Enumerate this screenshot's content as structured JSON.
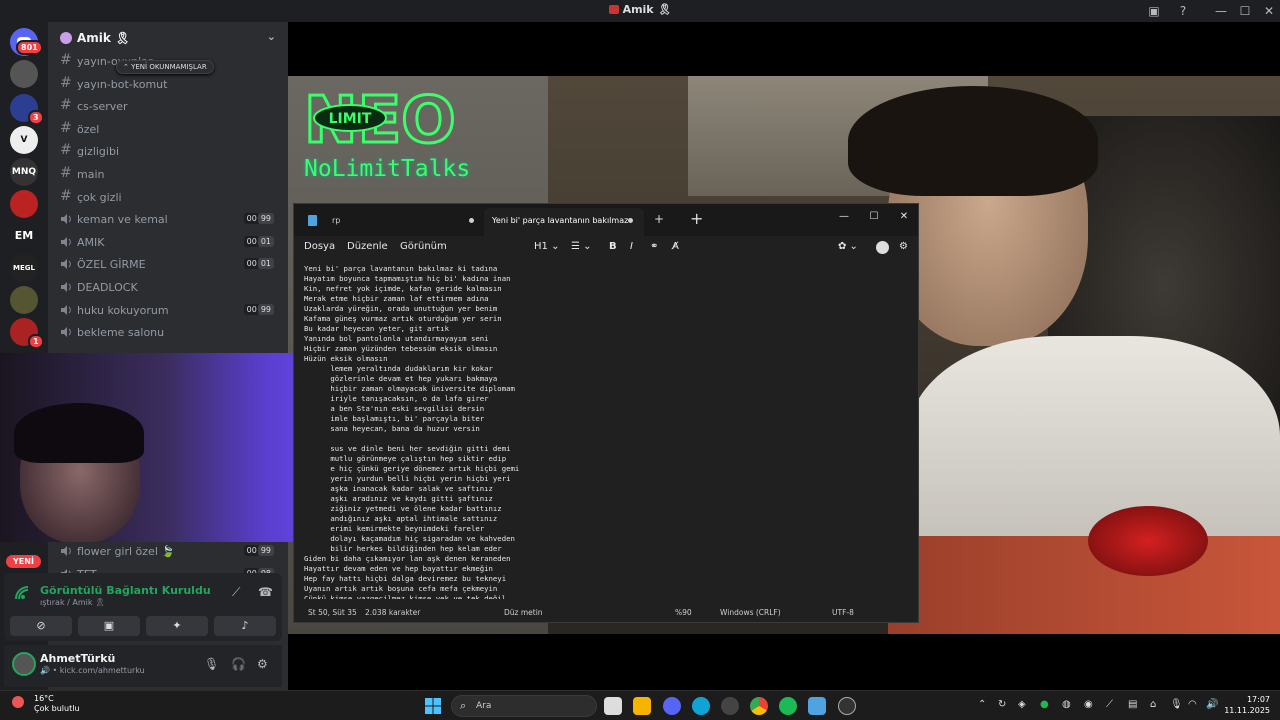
{
  "window": {
    "title": "Amik 🎗"
  },
  "servers": [
    {
      "name": "server-1",
      "badge": "801",
      "color": "#c0392b"
    },
    {
      "name": "server-2",
      "badge": "",
      "color": "#444"
    },
    {
      "name": "server-3",
      "badge": "3",
      "color": "#2c3e91"
    },
    {
      "name": "server-4",
      "badge": "",
      "color": "#eee"
    },
    {
      "name": "MNQ",
      "badge": "",
      "color": "#333"
    },
    {
      "name": "server-6",
      "badge": "",
      "color": "#b22"
    },
    {
      "name": "EM",
      "badge": "",
      "color": "#1e1f22"
    },
    {
      "name": "MEGL",
      "badge": "",
      "color": "#222"
    },
    {
      "name": "server-9",
      "badge": "",
      "color": "#553"
    },
    {
      "name": "server-10",
      "badge": "1",
      "color": "#a22"
    }
  ],
  "guild": {
    "name": "Amik 🎗"
  },
  "unread_pill": "YENİ OKUNMAMIŞLAR",
  "new_pill": "YENİ",
  "channels": [
    {
      "type": "text",
      "name": "yayın-oyunlar"
    },
    {
      "type": "text",
      "name": "yayın-bot-komut"
    },
    {
      "type": "text",
      "name": "cs-server"
    },
    {
      "type": "text",
      "name": "özel"
    },
    {
      "type": "text",
      "name": "gizligibi"
    },
    {
      "type": "text",
      "name": "main"
    },
    {
      "type": "text",
      "name": "çok gizli"
    },
    {
      "type": "voice",
      "name": "keman ve kemal",
      "c1": "00",
      "c2": "99"
    },
    {
      "type": "voice",
      "name": "AMIK",
      "c1": "00",
      "c2": "01"
    },
    {
      "type": "voice",
      "name": "ÖZEL GİRME",
      "c1": "00",
      "c2": "01"
    },
    {
      "type": "voice",
      "name": "DEADLOCK",
      "c1": "",
      "c2": ""
    },
    {
      "type": "voice",
      "name": "huku kokuyorum",
      "c1": "00",
      "c2": "99"
    },
    {
      "type": "voice",
      "name": "bekleme salonu",
      "c1": "",
      "c2": ""
    }
  ],
  "bottom_channels": [
    {
      "type": "voice",
      "name": "flower girl özel 🍃",
      "c1": "00",
      "c2": "99"
    },
    {
      "type": "voice",
      "name": "TFT",
      "c1": "00",
      "c2": "08"
    }
  ],
  "voice": {
    "status": "Görüntülü Bağlantı Kuruldu",
    "channel": "ıştırak / Amik 🎗"
  },
  "user": {
    "name": "AhmetTürkü",
    "status": "🔊 • kick.com/ahmetturku"
  },
  "stream": {
    "logo_text": "LIMIT",
    "brand": "NoLimitTalks"
  },
  "notepad": {
    "tabs": [
      {
        "label": "rp"
      },
      {
        "label": "Yeni bi' parça lavantanın bakılmaz"
      }
    ],
    "menu": [
      "Dosya",
      "Düzenle",
      "Görünüm"
    ],
    "heading": "H1",
    "lines": [
      "Yeni bi' parça lavantanın bakılmaz ki tadına",
      "Hayatım boyunca tapmamıştım hiç bi' kadına inan",
      "Kin, nefret yok içimde, kafan geride kalmasın",
      "Merak etme hiçbir zaman laf ettirmem adına",
      "Uzaklarda yüreğin, orada unuttuğun yer benim",
      "Kafama güneş vurmaz artık oturduğum yer serin",
      "Bu kadar heyecan yeter, git artık",
      "Yanında bol pantolonla utandırmayayım seni",
      "Hiçbir zaman yüzünden tebessüm eksik olmasın",
      "Hüzün eksik olmasın",
      "      lemem yeraltında dudaklarım kir kokar",
      "      gözlerinle devam et hep yukarı bakmaya",
      "      hiçbir zaman olmayacak üniversite diplomam",
      "      iriyle tanışacaksın, o da lafa girer",
      "      a ben Sta'nın eski sevgilisi dersin",
      "      imle başlamıştı, bi' parçayla biter",
      "      sana heyecan, bana da huzur versin",
      "",
      "      sus ve dinle beni her sevdiğin gitti demi",
      "      mutlu görünmeye çalıştın hep siktir edip",
      "      e hiç çünkü geriye dönemez artık hiçbi gemi",
      "      yerin yurdun belli hiçbi yerin hiçbi yeri",
      "      aşka inanacak kadar salak ve saftınız",
      "      aşkı aradınız ve kaydı gitti şaftınız",
      "      ziğiniz yetmedi ve ölene kadar battınız",
      "      andığınız aşkı aptal ihtimale sattınız",
      "      erimi kemirmekte beynimdeki fareler",
      "      dolayı kaçamadım hiç sigaradan ve kahveden",
      "      bilir herkes bildiğinden hep kelam eder",
      "Giden bi daha çıkamıyor lan aşk denen keraneden",
      "Hayattır devam eden ve hep bayattır ekmeğin",
      "Hep fay hattı hiçbi dalga deviremez bu tekneyi",
      "Uyanın artık artık boşuna cefa mefa çekmeyin",
      "Çünkü kimse vazgeçilmez kimse yek ve tek değil"
    ],
    "status": {
      "position": "St 50, Süt 35",
      "chars": "2.038 karakter",
      "mode": "Düz metin",
      "zoom": "%90",
      "eol": "Windows (CRLF)",
      "encoding": "UTF-8"
    }
  },
  "taskbar": {
    "weather_temp": "16°C",
    "weather_desc": "Çok bulutlu",
    "search_label": "Ara",
    "time": "17:07",
    "date": "11.11.2025"
  }
}
